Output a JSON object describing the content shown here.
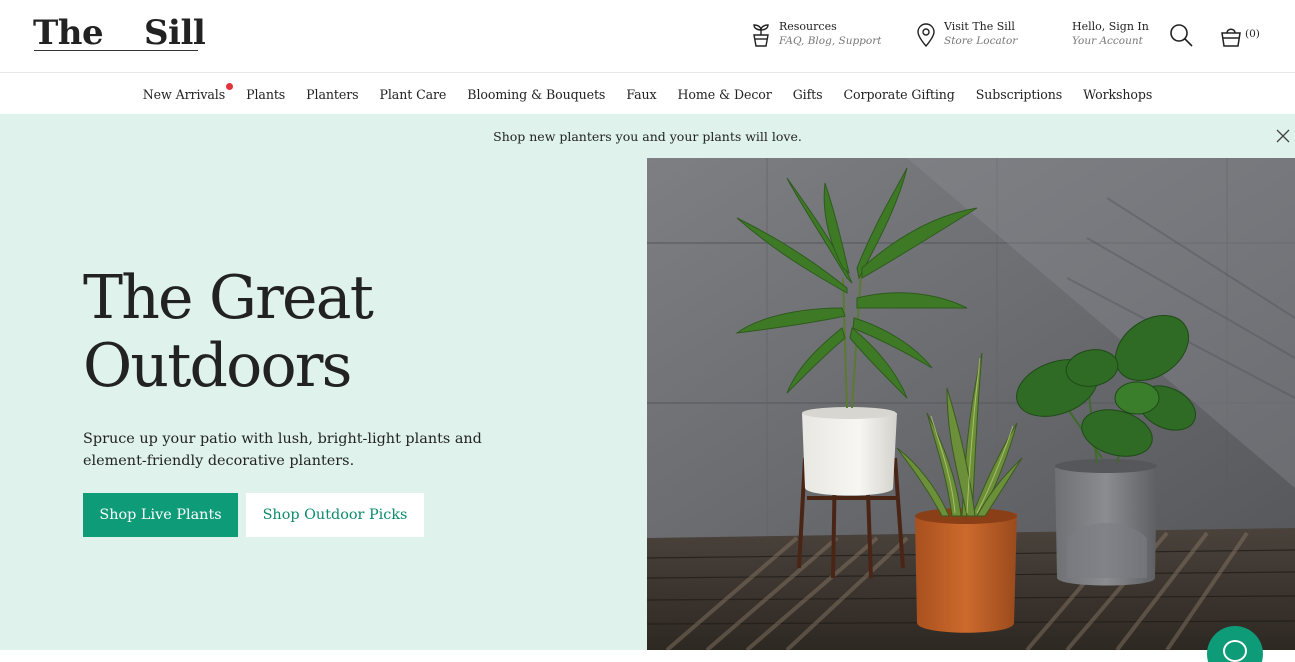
{
  "brand": {
    "logo_word1": "The",
    "logo_word2": "Sill"
  },
  "utility": {
    "resources": {
      "title": "Resources",
      "subtitle": "FAQ, Blog, Support"
    },
    "visit": {
      "title": "Visit The Sill",
      "subtitle": "Store Locator"
    },
    "account": {
      "title": "Hello, Sign In",
      "subtitle": "Your Account"
    },
    "cart": {
      "count": "(0)"
    },
    "icons": [
      "plant-icon",
      "location-pin-icon",
      "search-icon",
      "cart-icon"
    ]
  },
  "nav": {
    "items": [
      {
        "label": "New Arrivals",
        "badge_dot": true
      },
      {
        "label": "Plants"
      },
      {
        "label": "Planters"
      },
      {
        "label": "Plant Care"
      },
      {
        "label": "Blooming & Bouquets"
      },
      {
        "label": "Faux"
      },
      {
        "label": "Home & Decor"
      },
      {
        "label": "Gifts"
      },
      {
        "label": "Corporate Gifting"
      },
      {
        "label": "Subscriptions"
      },
      {
        "label": "Workshops"
      }
    ]
  },
  "announcement": {
    "text": "Shop new planters you and your plants will love."
  },
  "hero": {
    "title_line1": "The Great",
    "title_line2": "Outdoors",
    "subtitle": "Spruce up your patio with lush, bright-light plants and element-friendly decorative planters.",
    "primary_cta": "Shop Live Plants",
    "secondary_cta": "Shop Outdoor Picks"
  },
  "colors": {
    "accent_green": "#0d9b78",
    "mint_background": "#dff3ec",
    "badge_red": "#e1333b",
    "text": "#222222"
  }
}
